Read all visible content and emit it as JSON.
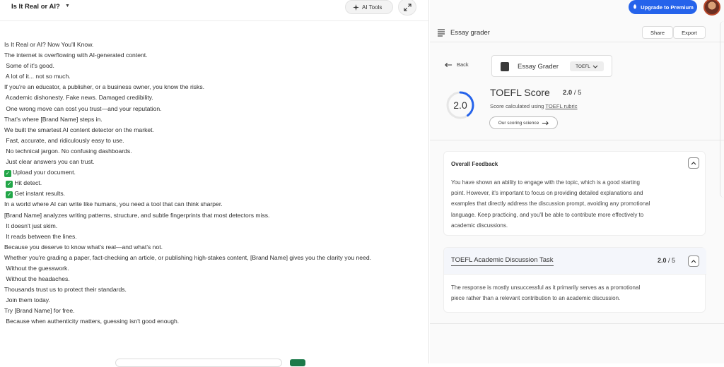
{
  "document": {
    "title": "Is It Real or AI?",
    "ai_tools_label": "AI Tools",
    "lines": [
      "Is It Real or AI? Now You'll Know.",
      "The internet is overflowing with AI-generated content.",
      " Some of it's good.",
      " A lot of it... not so much.",
      "If you're an educator, a publisher, or a business owner, you know the risks.",
      " Academic dishonesty. Fake news. Damaged credibility.",
      " One wrong move can cost you trust—and your reputation.",
      "That's where [Brand Name] steps in.",
      "We built the smartest AI content detector on the market.",
      " Fast, accurate, and ridiculously easy to use.",
      " No technical jargon. No confusing dashboards.",
      " Just clear answers you can trust."
    ],
    "checklist": [
      "Upload your document.",
      "Hit detect.",
      "Get instant results."
    ],
    "lines2": [
      "In a world where AI can write like humans, you need a tool that can think sharper.",
      "[Brand Name] analyzes writing patterns, structure, and subtle fingerprints that most detectors miss.",
      " It doesn't just skim.",
      " It reads between the lines.",
      "Because you deserve to know what's real—and what's not."
    ],
    "wrap_line": "Whether you're grading a paper, fact-checking an article, or publishing high-stakes content, [Brand Name] gives you the clarity you need.",
    "lines3": [
      " Without the guesswork.",
      " Without the headaches.",
      "Thousands trust us to protect their standards.",
      " Join them today.",
      "Try [Brand Name] for free.",
      " Because when authenticity matters, guessing isn't good enough."
    ]
  },
  "header": {
    "upgrade_label": "Upgrade to Premium"
  },
  "grader": {
    "panel_title": "Essay grader",
    "share_label": "Share",
    "export_label": "Export",
    "back_label": "Back",
    "card_label": "Essay Grader",
    "tag_label": "TOEFL",
    "score_display": "2.0",
    "score_title": "TOEFL Score",
    "score_value": "2.0",
    "score_max": "/ 5",
    "score_sub_prefix": "Score calculated using",
    "score_sub_link": "TOEFL rubric",
    "science_label": "Our scoring science",
    "score_fraction": 0.4
  },
  "feedback": {
    "title": "Overall Feedback",
    "text_lines": [
      "You have shown an ability to engage with the topic, which is a good starting",
      "point. However, it's important to focus on providing detailed explanations and",
      "examples that directly address the discussion prompt, avoiding any promotional",
      "language. Keep practicing, and you'll be able to contribute more effectively to",
      "academic discussions."
    ]
  },
  "task": {
    "title": "TOEFL Academic Discussion Task",
    "score": "2.0",
    "max": "/ 5",
    "text_lines": [
      "The response is mostly unsuccessful as it primarily serves as a promotional",
      "piece rather than a relevant contribution to an academic discussion."
    ]
  },
  "colors": {
    "accent_blue": "#2563eb",
    "check_green": "#22a648"
  }
}
